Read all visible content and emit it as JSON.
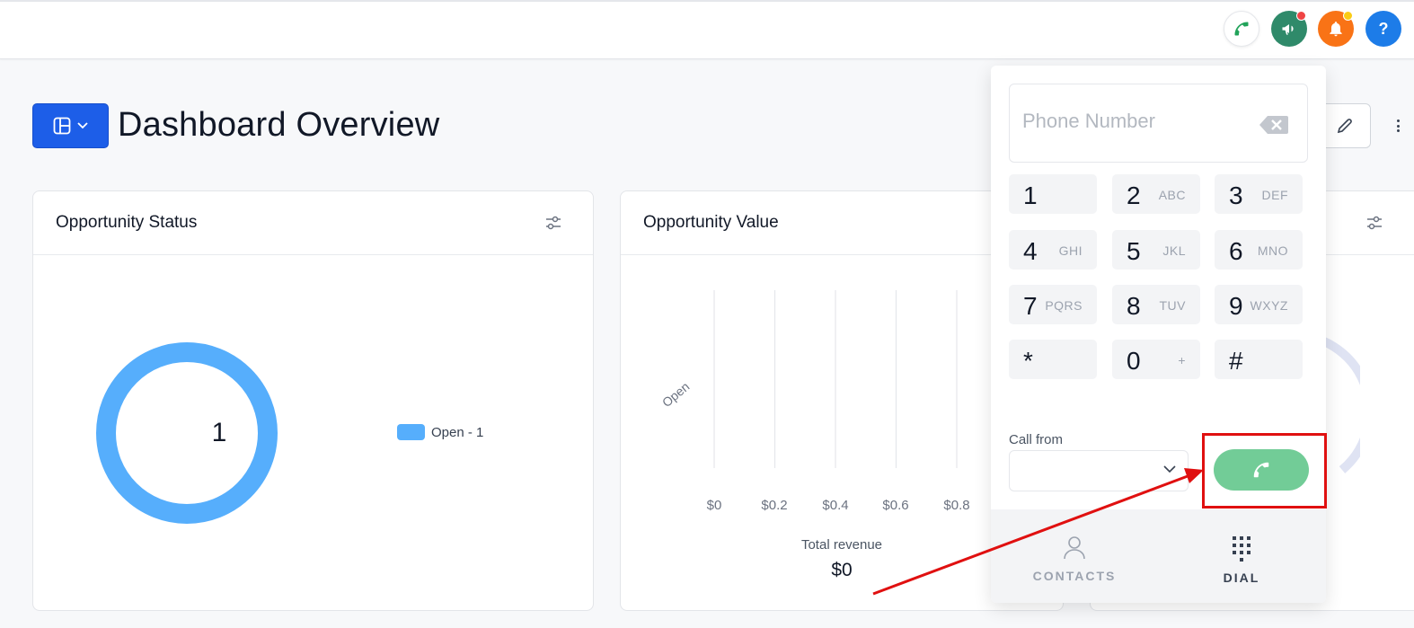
{
  "header": {
    "title": "Dashboard Overview",
    "icons": {
      "call": "phone-icon",
      "announce": "megaphone-icon",
      "notifications": "bell-icon",
      "help": "question-icon"
    },
    "help_label": "?"
  },
  "cards": [
    {
      "title": "Opportunity Status",
      "chart_data": {
        "type": "pie",
        "categories": [
          "Open - 1"
        ],
        "values": [
          1
        ],
        "center_label": "1",
        "colors": [
          "#56aefc"
        ]
      }
    },
    {
      "title": "Opportunity Value",
      "chart_data": {
        "type": "bar",
        "categories": [
          "Open"
        ],
        "values": [
          0
        ],
        "x_ticks": [
          "$0",
          "$0.2",
          "$0.4",
          "$0.6",
          "$0.8"
        ],
        "xlim": [
          0,
          1
        ],
        "grid": true
      },
      "footer_label": "Total revenue",
      "footer_value": "$0"
    },
    {
      "title": ""
    }
  ],
  "dialer": {
    "phone_placeholder": "Phone Number",
    "keys": [
      {
        "digit": "1",
        "letters": ""
      },
      {
        "digit": "2",
        "letters": "ABC"
      },
      {
        "digit": "3",
        "letters": "DEF"
      },
      {
        "digit": "4",
        "letters": "GHI"
      },
      {
        "digit": "5",
        "letters": "JKL"
      },
      {
        "digit": "6",
        "letters": "MNO"
      },
      {
        "digit": "7",
        "letters": "PQRS"
      },
      {
        "digit": "8",
        "letters": "TUV"
      },
      {
        "digit": "9",
        "letters": "WXYZ"
      },
      {
        "digit": "*",
        "letters": ""
      },
      {
        "digit": "0",
        "letters": "+"
      },
      {
        "digit": "#",
        "letters": ""
      }
    ],
    "call_from_label": "Call from",
    "call_from_value": "",
    "tabs": {
      "contacts": "CONTACTS",
      "dial": "DIAL"
    }
  },
  "colors": {
    "primary": "#1d5ee8",
    "call_green": "#72cc97",
    "donut": "#56aefc",
    "annotation": "#e01010"
  }
}
